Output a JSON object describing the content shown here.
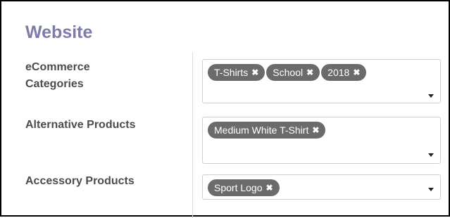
{
  "section": {
    "title": "Website"
  },
  "fields": {
    "ecommerce_categories": {
      "label": "eCommerce\nCategories",
      "tags": [
        "T-Shirts",
        "School",
        "2018"
      ]
    },
    "alternative_products": {
      "label": "Alternative Products",
      "tags": [
        "Medium White T-Shirt"
      ]
    },
    "accessory_products": {
      "label": "Accessory Products",
      "tags": [
        "Sport Logo"
      ]
    }
  },
  "icons": {
    "remove": "close-icon",
    "dropdown": "chevron-down-icon"
  },
  "colors": {
    "title": "#7c7bad",
    "tag_bg": "#6b6b6b",
    "tag_text": "#ffffff",
    "label": "#4c4c4c"
  }
}
